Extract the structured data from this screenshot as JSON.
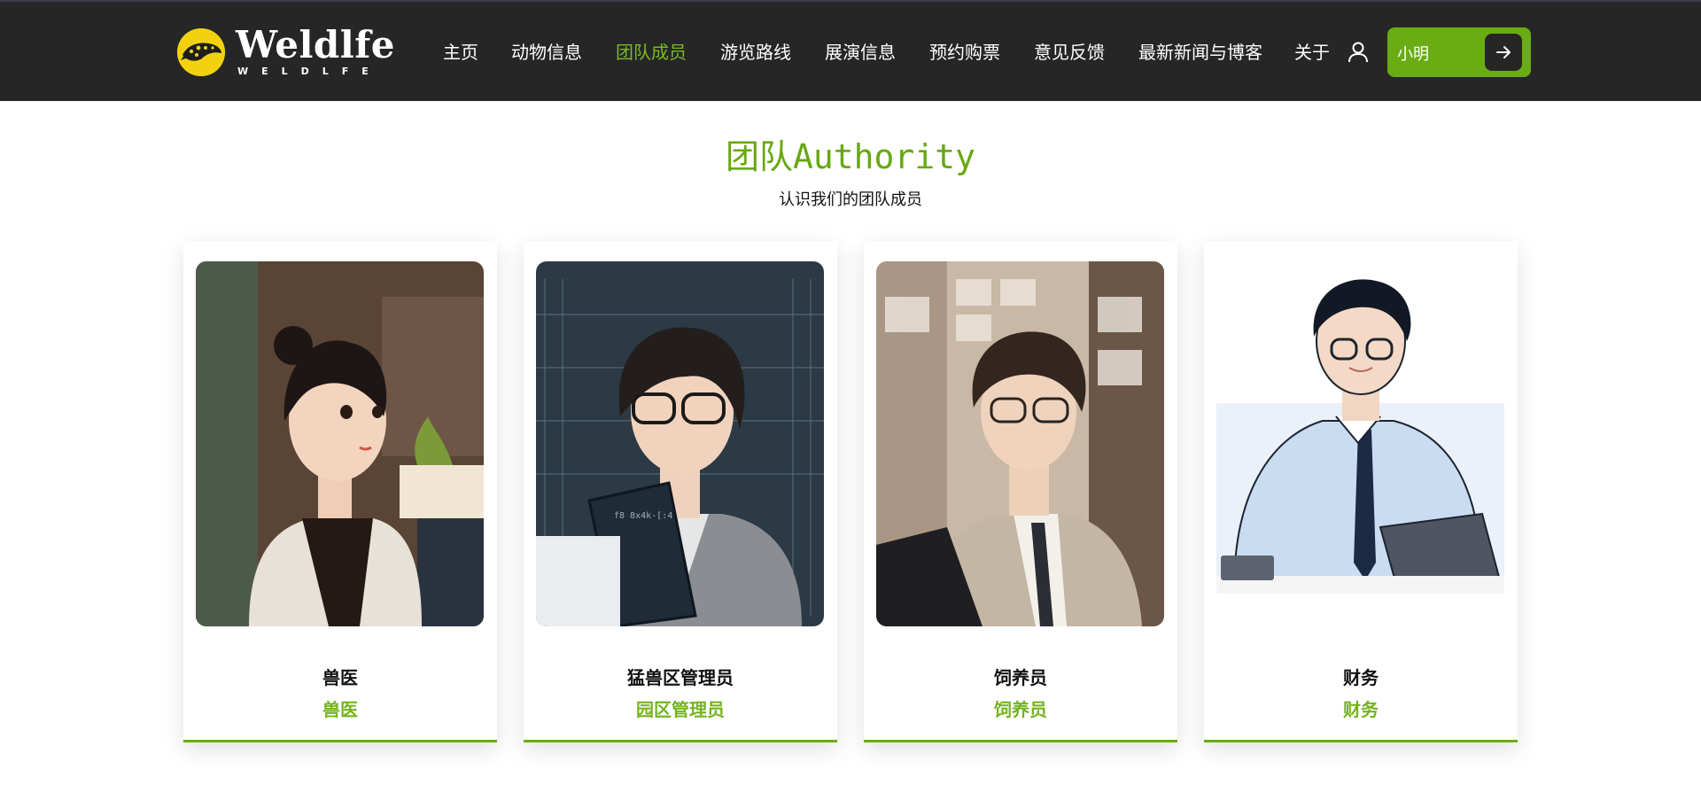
{
  "brand": {
    "title": "Weldlfe",
    "subtitle": "WELDLFE",
    "badge_icon": "leopard-logo-icon"
  },
  "nav": {
    "items": [
      {
        "label": "主页",
        "active": false
      },
      {
        "label": "动物信息",
        "active": false
      },
      {
        "label": "团队成员",
        "active": true
      },
      {
        "label": "游览路线",
        "active": false
      },
      {
        "label": "展演信息",
        "active": false
      },
      {
        "label": "预约购票",
        "active": false
      },
      {
        "label": "意见反馈",
        "active": false
      },
      {
        "label": "最新新闻与博客",
        "active": false
      },
      {
        "label": "关于",
        "active": false
      }
    ],
    "user_icon": "user-icon",
    "user_name": "小明",
    "user_action_icon": "arrow-right-icon"
  },
  "section": {
    "title": "团队Authority",
    "subtitle": "认识我们的团队成员"
  },
  "team": [
    {
      "name": "兽医",
      "role": "兽医"
    },
    {
      "name": "猛兽区管理员",
      "role": "园区管理员"
    },
    {
      "name": "饲养员",
      "role": "饲养员"
    },
    {
      "name": "财务",
      "role": "财务"
    }
  ],
  "colors": {
    "accent": "#6aac14",
    "header_bg": "#262626",
    "logo_yellow": "#f2d20f"
  }
}
